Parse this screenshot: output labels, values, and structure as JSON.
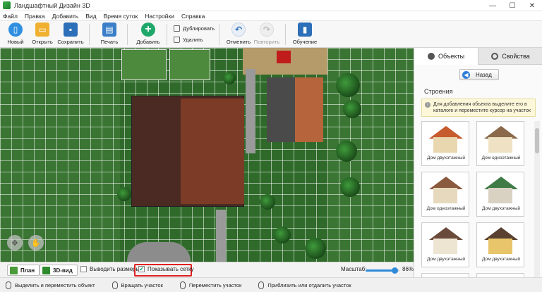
{
  "window": {
    "title": "Ландшафтный Дизайн 3D",
    "controls": {
      "minimize": "—",
      "maximize": "☐",
      "close": "✕"
    }
  },
  "menu": [
    "Файл",
    "Правка",
    "Добавить",
    "Вид",
    "Время суток",
    "Настройки",
    "Справка"
  ],
  "toolbar": {
    "new": "Новый",
    "open": "Открыть",
    "save": "Сохранить",
    "print": "Печать",
    "add": "Добавить",
    "duplicate": "Дублировать",
    "delete": "Удалить",
    "undo": "Отменить",
    "redo": "Повторить",
    "training": "Обучение"
  },
  "bottom": {
    "plan": "План",
    "view3d": "3D-вид",
    "show_sizes": "Выводить размеры",
    "show_grid": "Показывать сетку",
    "zoom_label": "Масштаб:",
    "zoom_value": "86%",
    "zoom_fraction": 0.86
  },
  "status": [
    "Выделить и переместить объект",
    "Вращать участок",
    "Переместить участок",
    "Приблизить или отдалить участок"
  ],
  "panel": {
    "tab_objects": "Объекты",
    "tab_properties": "Свойства",
    "back": "Назад",
    "section": "Строения",
    "hint": "Для добавления объекта выделите его в каталоге и переместите курсор на участок",
    "items": [
      {
        "name": "Дом двухэтажный",
        "roof": "#c65b2e",
        "wall": "#e9d7b0"
      },
      {
        "name": "Дом одноэтажный",
        "roof": "#8a6a4a",
        "wall": "#efe2c4"
      },
      {
        "name": "Дом одноэтажный",
        "roof": "#8a5a3e",
        "wall": "#e7d9bd"
      },
      {
        "name": "Дом двухэтажный",
        "roof": "#3f7b46",
        "wall": "#d9d2c3"
      },
      {
        "name": "Дом двухэтажный",
        "roof": "#6a4a3a",
        "wall": "#eee4d2"
      },
      {
        "name": "Дом двухэтажный",
        "roof": "#5a4030",
        "wall": "#e8c56a"
      }
    ]
  },
  "colors": {
    "accent": "#2e7ed8",
    "highlight": "#e02020",
    "grass": "#3a7533"
  }
}
